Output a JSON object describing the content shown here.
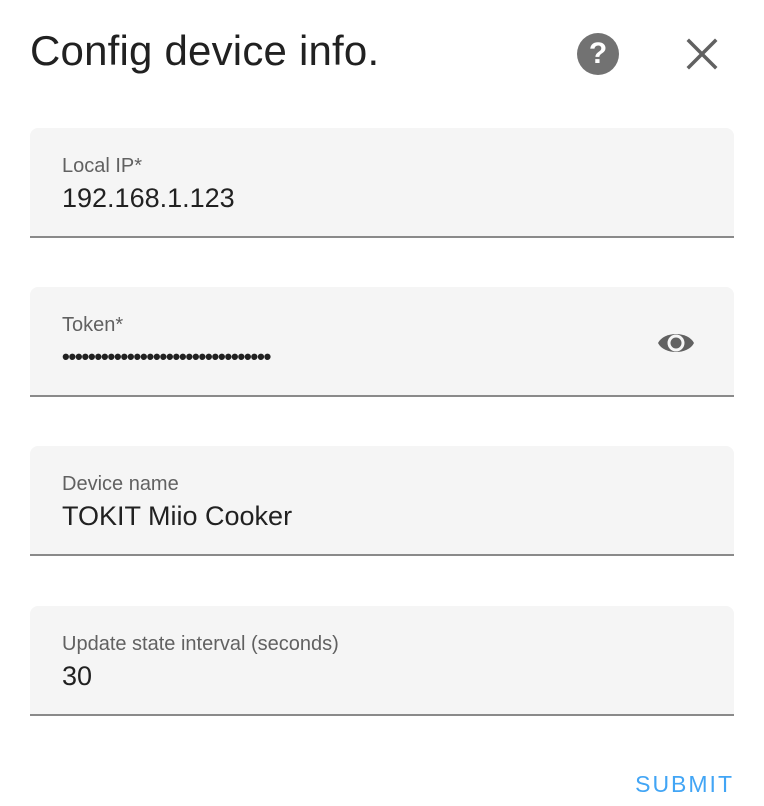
{
  "dialog": {
    "title": "Config device info.",
    "help_icon": "help-circle-icon",
    "help_glyph": "?",
    "close_icon": "close-icon"
  },
  "fields": {
    "local_ip": {
      "label": "Local IP*",
      "value": "192.168.1.123"
    },
    "token": {
      "label": "Token*",
      "masked_value": "••••••••••••••••••••••••••••••••",
      "toggle_icon": "eye-icon"
    },
    "device_name": {
      "label": "Device name",
      "value": "TOKIT Miio Cooker"
    },
    "update_interval": {
      "label": "Update state interval (seconds)",
      "value": "30"
    }
  },
  "actions": {
    "submit_label": "SUBMIT"
  },
  "colors": {
    "accent": "#42a5f5",
    "field_background": "#f5f5f5",
    "icon_gray": "#727272"
  }
}
